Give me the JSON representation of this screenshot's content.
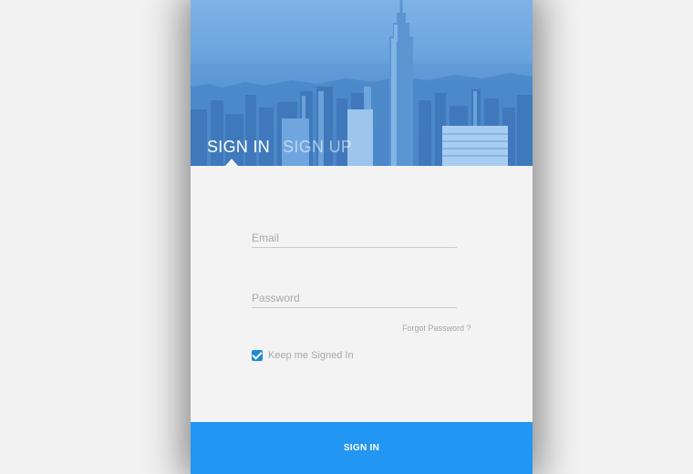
{
  "tabs": {
    "sign_in": "SIGN IN",
    "sign_up": "SIGN UP"
  },
  "form": {
    "email_placeholder": "Email",
    "email_value": "",
    "password_placeholder": "Password",
    "password_value": "",
    "forgot_password": "Forgot Password ?",
    "keep_signed_in_label": "Keep me Signed In",
    "keep_signed_in_checked": true,
    "submit_label": "SIGN IN"
  },
  "colors": {
    "accent": "#2196f3",
    "checkbox": "#1e88d9",
    "card_background": "#f3f3f3"
  },
  "icons": {
    "checkbox": "checkmark-icon",
    "tab_indicator": "triangle-up-icon"
  }
}
